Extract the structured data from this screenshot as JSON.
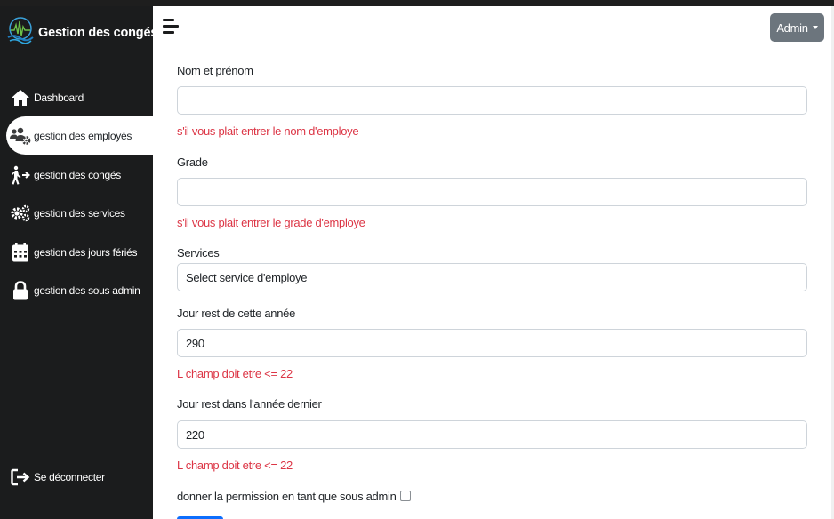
{
  "brand": {
    "title": "Gestion des congés"
  },
  "sidebar": {
    "items": [
      {
        "label": "Dashboard",
        "icon": "home-icon"
      },
      {
        "label": "gestion des employés",
        "icon": "users-cog-icon",
        "active": true
      },
      {
        "label": "gestion des congés",
        "icon": "walking-arrow-icon"
      },
      {
        "label": "gestion des services",
        "icon": "cogs-icon"
      },
      {
        "label": "gestion des jours fériés",
        "icon": "calendar-icon"
      },
      {
        "label": "gestion des sous admin",
        "icon": "lock-icon"
      }
    ],
    "logout": {
      "label": "Se déconnecter",
      "icon": "sign-out-icon"
    }
  },
  "header": {
    "user_button": "Admin"
  },
  "form": {
    "nom_label": "Nom et prénom",
    "nom_value": "",
    "nom_error": "s'il vous plait entrer le nom d'employe",
    "grade_label": "Grade",
    "grade_value": "",
    "grade_error": "s'il vous plait entrer le grade d'employe",
    "services_label": "Services",
    "services_selected": "Select service d'employe",
    "jour_rest_label": "Jour rest de cette année",
    "jour_rest_value": "290",
    "jour_rest_error": "L champ doit etre <= 22",
    "jour_rest_dernier_label": "Jour rest dans l'année dernier",
    "jour_rest_dernier_value": "220",
    "jour_rest_dernier_error": "L champ doit etre <= 22",
    "permission_label": "donner la permission en tant que sous admin"
  },
  "colors": {
    "sidebar_bg": "#1b1c1d",
    "error": "#dc3545",
    "admin_button": "#6c757d",
    "primary": "#0d6efd"
  }
}
